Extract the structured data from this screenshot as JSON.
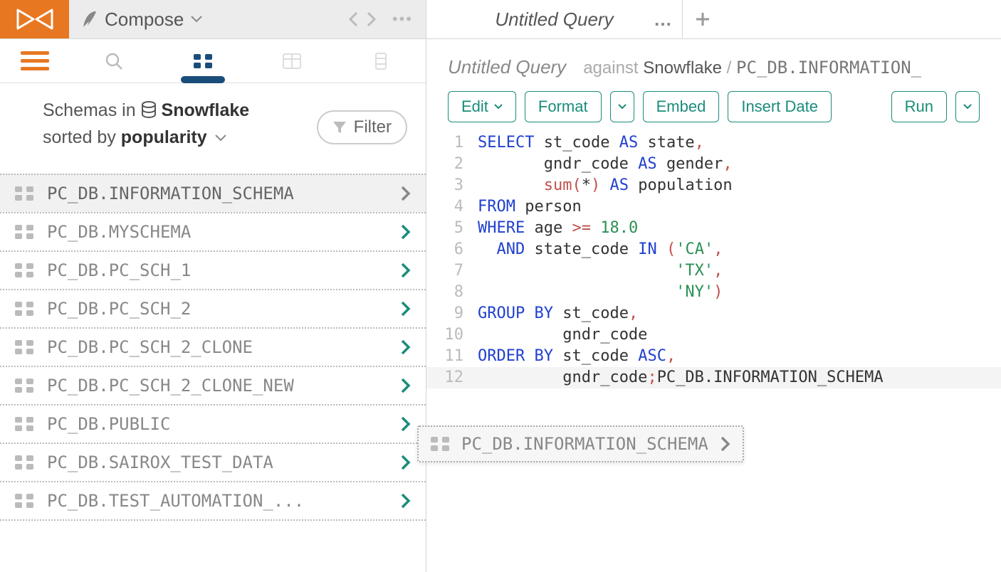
{
  "topbar": {
    "compose_label": "Compose",
    "tab_title": "Untitled Query"
  },
  "sidebar": {
    "heading_prefix": "Schemas in ",
    "connection": "Snowflake",
    "sorted_prefix": "sorted by ",
    "sorted_by": "popularity",
    "filter_label": "Filter",
    "items": [
      {
        "name": "PC_DB.INFORMATION_SCHEMA",
        "selected": true
      },
      {
        "name": "PC_DB.MYSCHEMA",
        "selected": false
      },
      {
        "name": "PC_DB.PC_SCH_1",
        "selected": false
      },
      {
        "name": "PC_DB.PC_SCH_2",
        "selected": false
      },
      {
        "name": "PC_DB.PC_SCH_2_CLONE",
        "selected": false
      },
      {
        "name": "PC_DB.PC_SCH_2_CLONE_NEW",
        "selected": false
      },
      {
        "name": "PC_DB.PUBLIC",
        "selected": false
      },
      {
        "name": "PC_DB.SAIROX_TEST_DATA",
        "selected": false
      },
      {
        "name": "PC_DB.TEST_AUTOMATION_...",
        "selected": false
      }
    ]
  },
  "query": {
    "title": "Untitled Query",
    "against_label": "against",
    "connection": "Snowflake",
    "schema": "PC_DB.INFORMATION_",
    "toolbar": {
      "edit": "Edit",
      "format": "Format",
      "embed": "Embed",
      "insert_date": "Insert Date",
      "run": "Run"
    },
    "code_lines": [
      {
        "n": 1,
        "tokens": [
          [
            "kw",
            "SELECT"
          ],
          [
            "",
            " "
          ],
          [
            "ident",
            "st_code"
          ],
          [
            "",
            " "
          ],
          [
            "kw",
            "AS"
          ],
          [
            "",
            " "
          ],
          [
            "ident",
            "state"
          ],
          [
            "punc",
            ","
          ]
        ]
      },
      {
        "n": 2,
        "tokens": [
          [
            "",
            "       "
          ],
          [
            "ident",
            "gndr_code"
          ],
          [
            "",
            " "
          ],
          [
            "kw",
            "AS"
          ],
          [
            "",
            " "
          ],
          [
            "ident",
            "gender"
          ],
          [
            "punc",
            ","
          ]
        ]
      },
      {
        "n": 3,
        "tokens": [
          [
            "",
            "       "
          ],
          [
            "fn",
            "sum"
          ],
          [
            "punc",
            "("
          ],
          [
            "ident",
            "*"
          ],
          [
            "punc",
            ")"
          ],
          [
            "",
            " "
          ],
          [
            "kw",
            "AS"
          ],
          [
            "",
            " "
          ],
          [
            "ident",
            "population"
          ]
        ]
      },
      {
        "n": 4,
        "tokens": [
          [
            "kw",
            "FROM"
          ],
          [
            "",
            " "
          ],
          [
            "ident",
            "person"
          ]
        ]
      },
      {
        "n": 5,
        "tokens": [
          [
            "kw",
            "WHERE"
          ],
          [
            "",
            " "
          ],
          [
            "ident",
            "age"
          ],
          [
            "",
            " "
          ],
          [
            "punc",
            ">="
          ],
          [
            "",
            " "
          ],
          [
            "num",
            "18.0"
          ]
        ]
      },
      {
        "n": 6,
        "tokens": [
          [
            "",
            "  "
          ],
          [
            "kw",
            "AND"
          ],
          [
            "",
            " "
          ],
          [
            "ident",
            "state_code"
          ],
          [
            "",
            " "
          ],
          [
            "kw",
            "IN"
          ],
          [
            "",
            " "
          ],
          [
            "punc",
            "("
          ],
          [
            "str",
            "'CA'"
          ],
          [
            "punc",
            ","
          ]
        ]
      },
      {
        "n": 7,
        "tokens": [
          [
            "",
            "                     "
          ],
          [
            "str",
            "'TX'"
          ],
          [
            "punc",
            ","
          ]
        ]
      },
      {
        "n": 8,
        "tokens": [
          [
            "",
            "                     "
          ],
          [
            "str",
            "'NY'"
          ],
          [
            "punc",
            ")"
          ]
        ]
      },
      {
        "n": 9,
        "tokens": [
          [
            "kw",
            "GROUP"
          ],
          [
            "",
            " "
          ],
          [
            "kw",
            "BY"
          ],
          [
            "",
            " "
          ],
          [
            "ident",
            "st_code"
          ],
          [
            "punc",
            ","
          ]
        ]
      },
      {
        "n": 10,
        "tokens": [
          [
            "",
            "         "
          ],
          [
            "ident",
            "gndr_code"
          ]
        ]
      },
      {
        "n": 11,
        "tokens": [
          [
            "kw",
            "ORDER"
          ],
          [
            "",
            " "
          ],
          [
            "kw",
            "BY"
          ],
          [
            "",
            " "
          ],
          [
            "ident",
            "st_code"
          ],
          [
            "",
            " "
          ],
          [
            "kw",
            "ASC"
          ],
          [
            "punc",
            ","
          ]
        ]
      },
      {
        "n": 12,
        "hl": true,
        "tokens": [
          [
            "",
            "         "
          ],
          [
            "ident",
            "gndr_code"
          ],
          [
            "punc",
            ";"
          ],
          [
            "ident",
            "PC_DB.INFORMATION_SCHEMA"
          ]
        ]
      }
    ]
  },
  "drag_chip": {
    "label": "PC_DB.INFORMATION_SCHEMA"
  }
}
